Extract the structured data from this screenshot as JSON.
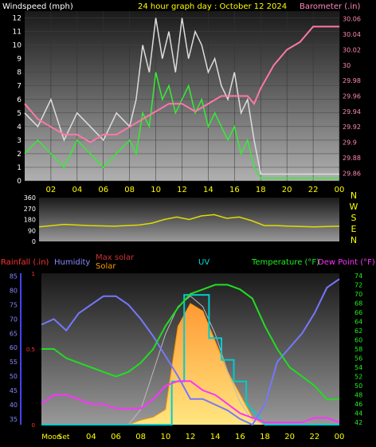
{
  "header": {
    "left_label": "Windspeed (mph)",
    "center_label": "24 hour graph day : October 12 2024",
    "right_label": "Barometer (.in)"
  },
  "colors": {
    "wind_gust": "#dddddd",
    "wind_avg": "#33ee33",
    "barometer": "#ff77aa",
    "direction": "#dddd00",
    "rain": "#ff3333",
    "humidity": "#7777ff",
    "solar": "#ff9900",
    "max_solar": "#cc3333",
    "uv": "#00cccc",
    "temperature": "#22dd22",
    "dew_point": "#ff33ff",
    "axis_gold": "#dddd00",
    "gradient_top": "#222222",
    "gradient_bottom": "#aaaaaa"
  },
  "chart_data": [
    {
      "type": "line",
      "name": "wind-barometer",
      "x_ticks": [
        "02",
        "04",
        "06",
        "08",
        "10",
        "12",
        "14",
        "16",
        "18",
        "20",
        "22",
        "00"
      ],
      "y_left_ticks": [
        "0",
        "1",
        "2",
        "3",
        "4",
        "5",
        "6",
        "7",
        "8",
        "9",
        "10",
        "11",
        "12"
      ],
      "y_left_range": [
        0,
        12.5
      ],
      "y_right_ticks": [
        "29.86",
        "29.88",
        "29.9",
        "29.92",
        "29.94",
        "29.96",
        "29.98",
        "30",
        "30.02",
        "30.04",
        "30.06"
      ],
      "y_right_range": [
        29.85,
        30.07
      ],
      "x_range_hours": [
        0,
        24
      ],
      "series": [
        {
          "role": "gust",
          "x": [
            0,
            1,
            2,
            3,
            4,
            5,
            6,
            7,
            8,
            8.5,
            9,
            9.5,
            10,
            10.5,
            11,
            11.5,
            12,
            12.5,
            13,
            13.5,
            14,
            14.5,
            15,
            15.5,
            16,
            16.5,
            17,
            17.5,
            18,
            18.5,
            24
          ],
          "y": [
            5,
            4,
            6,
            3,
            5,
            4,
            3,
            5,
            4,
            6,
            10,
            8,
            12,
            9,
            11,
            8,
            12,
            9,
            11,
            10,
            8,
            9,
            7,
            6,
            8,
            5,
            6,
            3,
            0.5,
            0.5,
            0.5
          ]
        },
        {
          "role": "average",
          "x": [
            0,
            1,
            2,
            3,
            4,
            5,
            6,
            7,
            8,
            8.5,
            9,
            9.5,
            10,
            10.5,
            11,
            11.5,
            12,
            12.5,
            13,
            13.5,
            14,
            14.5,
            15,
            15.5,
            16,
            16.5,
            17,
            17.5,
            18,
            18.5,
            24
          ],
          "y": [
            2,
            3,
            2,
            1,
            3,
            2,
            1,
            2,
            3,
            2,
            5,
            4,
            8,
            6,
            7,
            5,
            6,
            7,
            5,
            6,
            4,
            5,
            4,
            3,
            4,
            2,
            3,
            1,
            0.2,
            0.2,
            0.2
          ]
        },
        {
          "role": "barometer",
          "x": [
            0,
            1,
            2,
            3,
            4,
            5,
            6,
            7,
            8,
            9,
            10,
            11,
            12,
            13,
            14,
            15,
            16,
            17,
            17.5,
            18,
            19,
            20,
            21,
            22,
            23,
            24
          ],
          "y": [
            29.95,
            29.93,
            29.92,
            29.91,
            29.91,
            29.9,
            29.91,
            29.91,
            29.92,
            29.93,
            29.94,
            29.95,
            29.95,
            29.94,
            29.95,
            29.96,
            29.96,
            29.96,
            29.95,
            29.97,
            30.0,
            30.02,
            30.03,
            30.05,
            30.05,
            30.05
          ]
        }
      ]
    },
    {
      "type": "line",
      "name": "wind-direction",
      "y_left_ticks": [
        "360",
        "270",
        "180",
        "90",
        "0"
      ],
      "y_left_range": [
        0,
        360
      ],
      "y_right_labels": [
        "N",
        "W",
        "S",
        "E",
        "N"
      ],
      "x_range_hours": [
        0,
        24
      ],
      "series": [
        {
          "role": "direction",
          "x": [
            0,
            2,
            4,
            6,
            8,
            9,
            10,
            11,
            12,
            13,
            14,
            15,
            16,
            17,
            18,
            19,
            20,
            22,
            24
          ],
          "y": [
            120,
            140,
            130,
            125,
            135,
            150,
            180,
            200,
            180,
            210,
            220,
            190,
            200,
            170,
            130,
            130,
            125,
            120,
            125
          ]
        }
      ]
    },
    {
      "type": "line",
      "name": "solar-humidity-temperature",
      "legend": [
        "Rainfall (.in)",
        "Humidity",
        "Max solar",
        "Solar",
        "UV",
        "Temperature (°F)",
        "Dew Point (°F)"
      ],
      "x_ticks": [
        "Moon",
        "Set",
        "04",
        "06",
        "08",
        "10",
        "12",
        "14",
        "16",
        "18",
        "20",
        "22",
        "00"
      ],
      "y_left_ticks": [
        "35",
        "40",
        "45",
        "50",
        "55",
        "60",
        "65",
        "70",
        "75",
        "80",
        "85"
      ],
      "y_left_range": [
        33,
        86
      ],
      "rain_ticks": [
        "0",
        "0.5",
        "1"
      ],
      "y_right_ticks": [
        "42",
        "44",
        "46",
        "48",
        "50",
        "52",
        "54",
        "56",
        "58",
        "60",
        "62",
        "64",
        "66",
        "68",
        "70",
        "72",
        "74"
      ],
      "y_right_range": [
        41.5,
        74.5
      ],
      "x_range_hours": [
        0,
        24
      ],
      "series": [
        {
          "role": "humidity",
          "x": [
            0,
            1,
            2,
            3,
            4,
            5,
            6,
            7,
            8,
            9,
            10,
            11,
            12,
            13,
            14,
            15,
            16,
            17,
            18,
            19,
            20,
            21,
            22,
            23,
            24
          ],
          "y": [
            68,
            70,
            66,
            72,
            75,
            78,
            78,
            75,
            70,
            64,
            57,
            50,
            42,
            42,
            40,
            38,
            35,
            33,
            40,
            55,
            60,
            65,
            72,
            81,
            84
          ]
        },
        {
          "role": "temperature",
          "x": [
            0,
            1,
            2,
            3,
            4,
            5,
            6,
            7,
            8,
            9,
            10,
            11,
            12,
            13,
            14,
            15,
            16,
            17,
            18,
            19,
            20,
            21,
            22,
            23,
            24
          ],
          "y": [
            58,
            58,
            56,
            55,
            54,
            53,
            52,
            53,
            55,
            58,
            63,
            67,
            70,
            71,
            72,
            72,
            71,
            69,
            63,
            58,
            54,
            52,
            50,
            47,
            47
          ]
        },
        {
          "role": "dew_point",
          "x": [
            0,
            1,
            2,
            3,
            4,
            5,
            6,
            7,
            8,
            9,
            10,
            11,
            12,
            13,
            14,
            15,
            16,
            17,
            18,
            19,
            20,
            21,
            22,
            23,
            24
          ],
          "y": [
            46,
            48,
            48,
            47,
            46,
            46,
            45,
            45,
            45,
            47,
            50,
            51,
            51,
            49,
            48,
            46,
            44,
            43,
            42,
            42,
            42,
            42,
            43,
            43,
            42
          ]
        },
        {
          "role": "uv",
          "x": [
            0,
            10.5,
            10.5,
            11.5,
            11.5,
            13.5,
            13.5,
            14.5,
            14.5,
            15.5,
            15.5,
            16.5,
            16.5,
            18,
            24
          ],
          "y": [
            0,
            0,
            1,
            1,
            3,
            3,
            2,
            2,
            1.5,
            1.5,
            1,
            1,
            0.5,
            0,
            0
          ]
        },
        {
          "role": "max_solar",
          "x": [
            0,
            7,
            8,
            9,
            10,
            11,
            12,
            13,
            14,
            15,
            16,
            17,
            18,
            24
          ],
          "y": [
            0,
            0,
            10,
            35,
            60,
            78,
            85,
            78,
            60,
            35,
            15,
            3,
            0,
            0
          ]
        },
        {
          "role": "solar",
          "x": [
            0,
            7,
            8,
            9,
            10,
            11,
            12,
            13,
            14,
            15,
            16,
            17,
            18,
            24
          ],
          "y": [
            0,
            0,
            3,
            5,
            10,
            65,
            80,
            75,
            55,
            35,
            20,
            5,
            0,
            0
          ]
        }
      ],
      "uv_scale_max": 3.5,
      "solar_scale_max": 100
    }
  ]
}
